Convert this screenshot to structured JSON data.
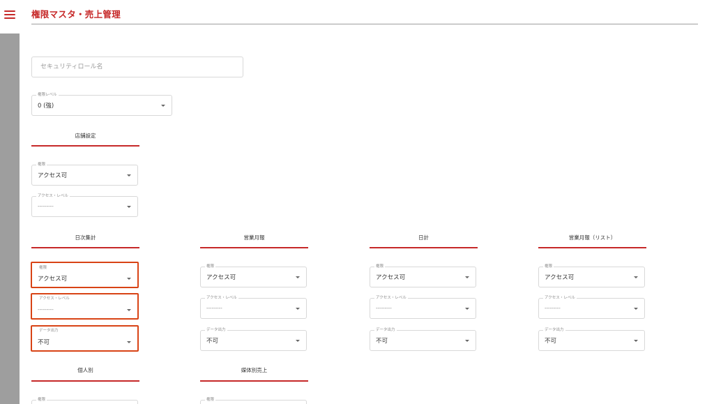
{
  "header": {
    "title": "権限マスタ・売上管理",
    "menu_icon": "hamburger-menu-icon"
  },
  "role_name": {
    "placeholder": "セキュリティロール名",
    "value": ""
  },
  "level": {
    "label": "権限レベル",
    "value": "0 (強)"
  },
  "store_settings": {
    "title": "店舗設定",
    "permission": {
      "label": "権限",
      "value": "アクセス可"
    },
    "access_level": {
      "label": "アクセス・レベル",
      "value": "---------"
    }
  },
  "modules": [
    {
      "title": "日次集計",
      "highlighted": true,
      "permission": {
        "label": "権限",
        "value": "アクセス可"
      },
      "access_level": {
        "label": "アクセス・レベル",
        "value": "---------"
      },
      "data_output": {
        "label": "データ出力",
        "value": "不可"
      }
    },
    {
      "title": "営業月報",
      "highlighted": false,
      "permission": {
        "label": "権限",
        "value": "アクセス可"
      },
      "access_level": {
        "label": "アクセス・レベル",
        "value": "---------"
      },
      "data_output": {
        "label": "データ出力",
        "value": "不可"
      }
    },
    {
      "title": "日計",
      "highlighted": false,
      "permission": {
        "label": "権限",
        "value": "アクセス可"
      },
      "access_level": {
        "label": "アクセス・レベル",
        "value": "---------"
      },
      "data_output": {
        "label": "データ出力",
        "value": "不可"
      }
    },
    {
      "title": "営業月報（リスト）",
      "highlighted": false,
      "permission": {
        "label": "権限",
        "value": "アクセス可"
      },
      "access_level": {
        "label": "アクセス・レベル",
        "value": "---------"
      },
      "data_output": {
        "label": "データ出力",
        "value": "不可"
      }
    }
  ],
  "lower_modules": [
    {
      "title": "個人別",
      "permission": {
        "label": "権限"
      }
    },
    {
      "title": "媒体別売上",
      "permission": {
        "label": "権限"
      }
    }
  ],
  "colors": {
    "accent": "#c62828",
    "highlight": "#d84315",
    "sidebar": "#9e9e9e"
  }
}
